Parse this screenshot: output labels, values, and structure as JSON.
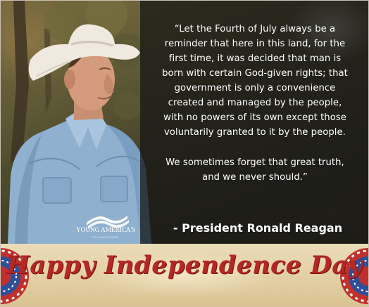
{
  "quote": {
    "lines": [
      "“Let the Fourth of July always be a",
      "reminder that here in this land, for the",
      "first time, it was decided that man is",
      "born with certain God-given rights; that",
      "government is only a convenience",
      "created and managed by the people,",
      "with no powers of its own except those",
      "voluntarily granted to it by the people."
    ],
    "closing_lines": [
      "We sometimes forget that great truth,",
      "and we never should.”"
    ],
    "attribution": "- President Ronald Reagan"
  },
  "logo": {
    "name": "YOUNG AMERICA'S",
    "sub": "FOUNDATION",
    "icon": "flag-wave-icon"
  },
  "banner": {
    "title": "Happy Independence Day"
  },
  "colors": {
    "title_red": "#b32724",
    "panel": "#161614",
    "banner_tan": "#e3d1a6",
    "rosette_red": "#c0302c",
    "rosette_blue": "#2e4f9a"
  }
}
